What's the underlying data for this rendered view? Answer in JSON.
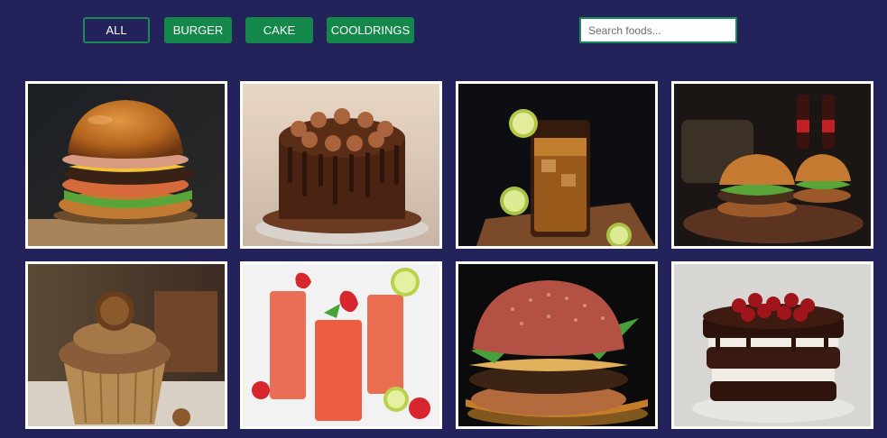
{
  "filters": {
    "all": "ALL",
    "burger": "BURGER",
    "cake": "CAKE",
    "cooldrings": "COOLDRINGS"
  },
  "search": {
    "placeholder": "Search foods...",
    "value": ""
  },
  "colors": {
    "background": "#23225a",
    "button": "#14874a",
    "card_border": "#ffffff"
  },
  "gallery": {
    "items": [
      {
        "category": "burger"
      },
      {
        "category": "cake"
      },
      {
        "category": "cooldrings"
      },
      {
        "category": "burger"
      },
      {
        "category": "cake"
      },
      {
        "category": "cooldrings"
      },
      {
        "category": "burger"
      },
      {
        "category": "cake"
      }
    ]
  }
}
